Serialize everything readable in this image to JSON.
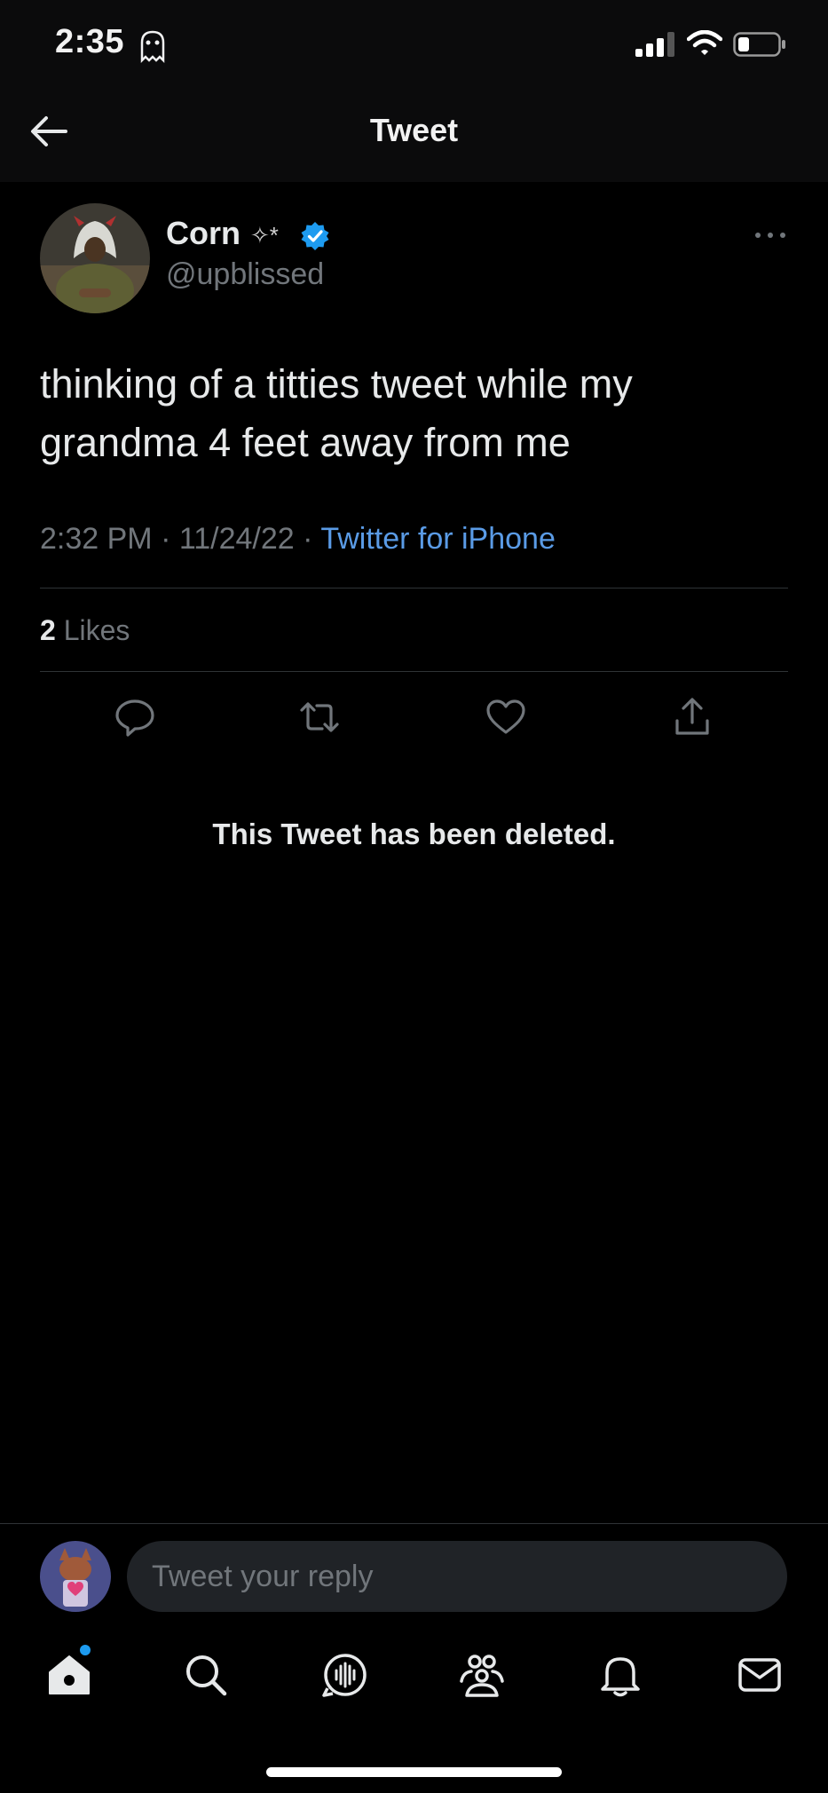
{
  "status_bar": {
    "time": "2:35",
    "emoji_icon": "ghost-emoji",
    "signal_icon": "cell-signal-icon",
    "wifi_icon": "wifi-icon",
    "battery_icon": "battery-icon"
  },
  "header": {
    "title": "Tweet",
    "back_icon": "back-arrow-icon"
  },
  "tweet": {
    "author": {
      "display_name": "Corn",
      "name_decoration": "✧*",
      "handle": "@upblissed",
      "verified": true
    },
    "text": "thinking of a titties tweet while my grandma 4 feet away from me",
    "time": "2:32 PM",
    "date": "11/24/22",
    "separator": "·",
    "source": "Twitter for iPhone",
    "likes_count": "2",
    "likes_label": "Likes",
    "actions": [
      "reply-icon",
      "retweet-icon",
      "like-icon",
      "share-icon"
    ]
  },
  "deleted_notice": "This Tweet has been deleted.",
  "reply": {
    "placeholder": "Tweet your reply"
  },
  "bottom_nav": [
    "home-icon",
    "search-icon",
    "spaces-icon",
    "communities-icon",
    "notifications-icon",
    "messages-icon"
  ],
  "colors": {
    "background": "#000000",
    "link": "#5a9be6",
    "muted": "#71767b",
    "verified": "#1d9bf0",
    "input_bg": "#202327"
  }
}
